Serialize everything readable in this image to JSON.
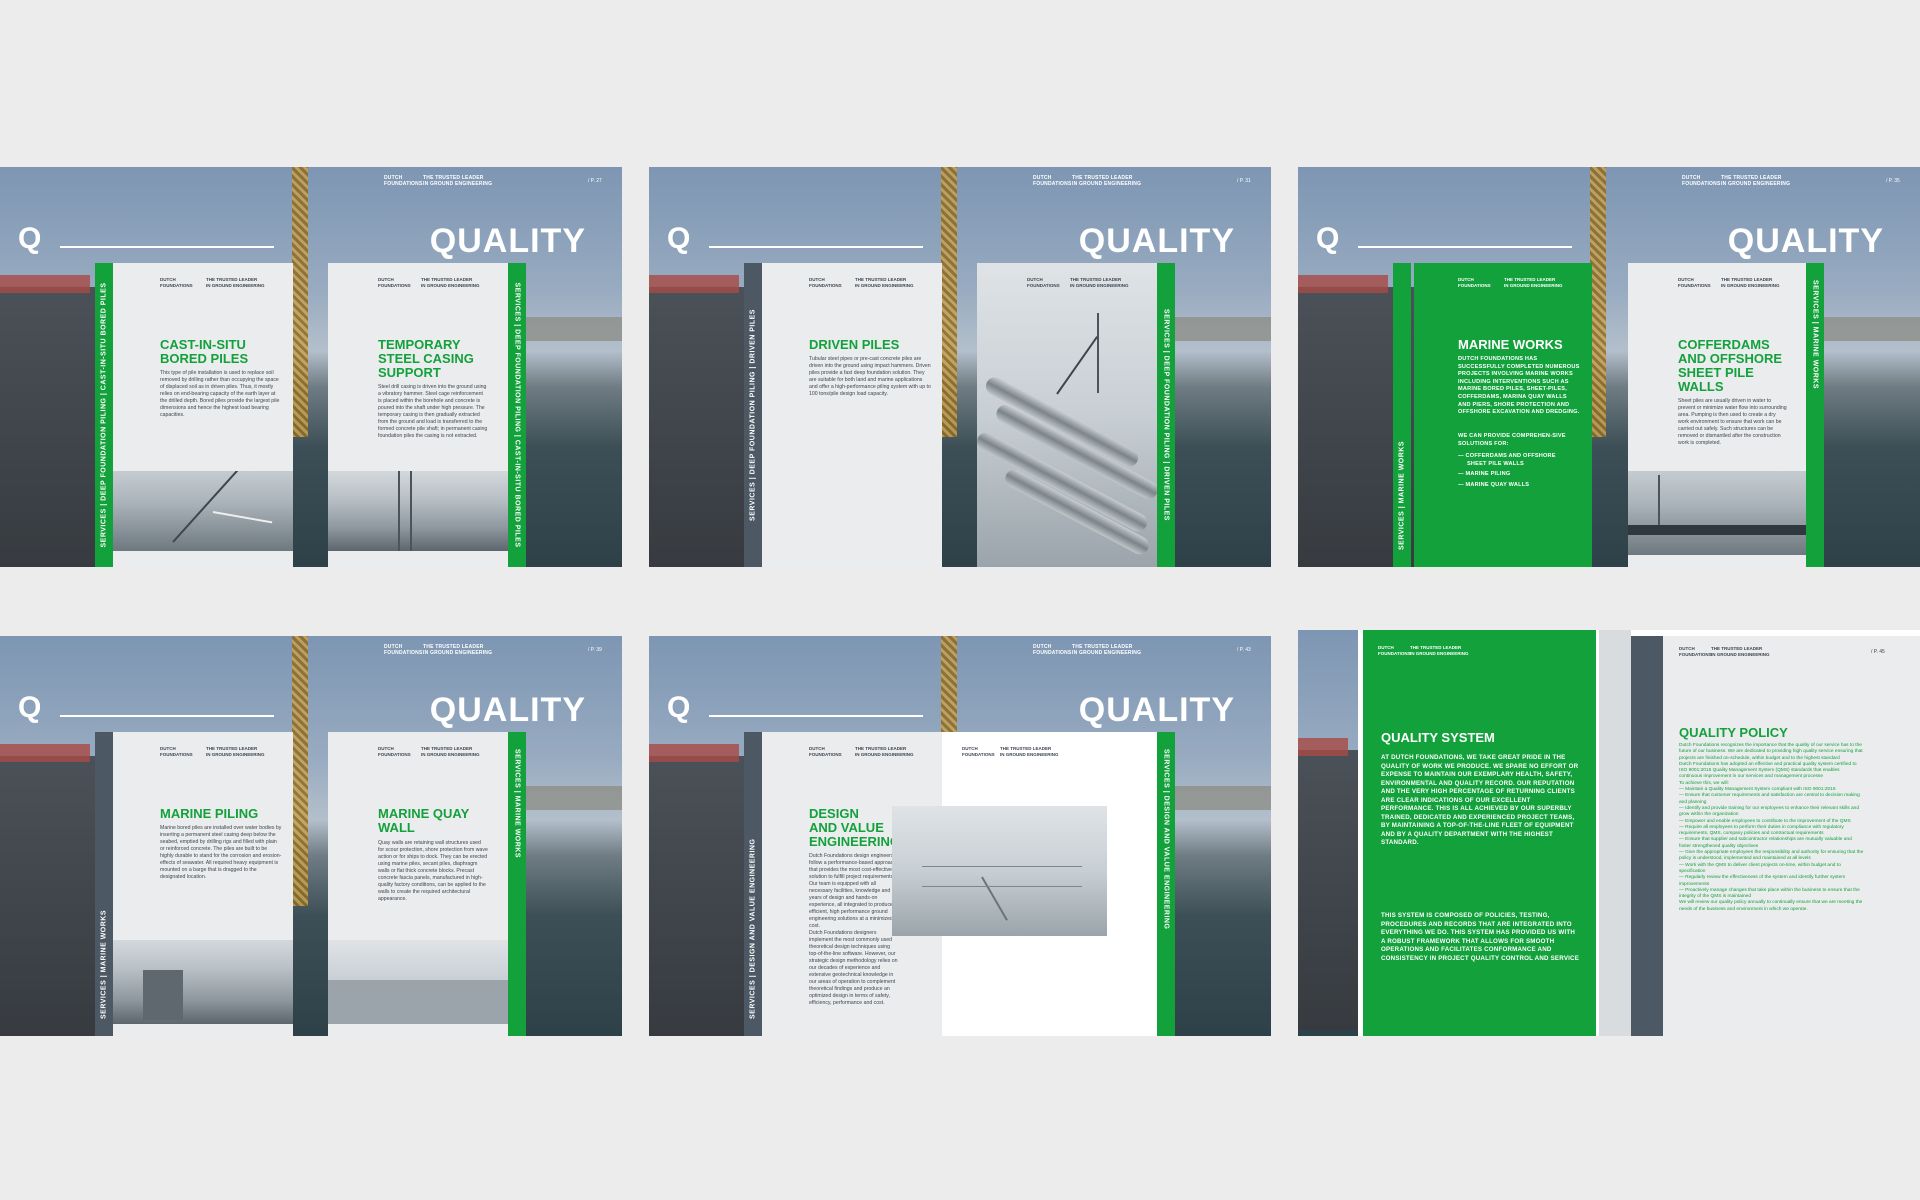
{
  "header": {
    "company_line1": "DUTCH",
    "company_line2": "FOUNDATIONS",
    "tag_line1": "THE TRUSTED LEADER",
    "tag_line2": "IN GROUND ENGINEERING"
  },
  "pages": {
    "p1": "/ P. 27",
    "p2": "/ P. 31",
    "p3": "/ P. 35",
    "p4": "/ P. 39",
    "p5": "/ P. 43",
    "p6": "/ P. 45"
  },
  "cover": {
    "letter": "Q",
    "word": "QUALITY"
  },
  "side": {
    "services": "SERVICES",
    "deep": "DEEP FOUNDATION PILING",
    "cast": "CAST-IN-SITU BORED PILES",
    "driven": "DRIVEN PILES",
    "marine": "MARINE WORKS",
    "design": "DESIGN AND VALUE ENGINEERING"
  },
  "s1": {
    "t1_l1": "CAST-IN-SITU",
    "t1_l2": "BORED PILES",
    "b1": "This type of pile installation is used to replace soil removed by drilling rather than occupying the space of displaced soil as in driven piles. Thus, it mostly relies on end-bearing capacity of the earth layer at the drilled depth. Bored piles provide the largest pile dimensions and hence the highest load bearing capacities.",
    "t2_l1": "TEMPORARY",
    "t2_l2": "STEEL CASING",
    "t2_l3": "SUPPORT",
    "b2": "Steel drill casing is driven into the ground using a vibratory hammer. Steel cage reinforcement is placed within the borehole and concrete is poured into the shaft under high pressure. The temporary casing is then gradually extracted from the ground and load is transferred to the formed concrete pile shaft; in permanent casing foundation piles the casing is not extracted."
  },
  "s2": {
    "t1": "DRIVEN PILES",
    "b1": "Tubular steel pipes or pre-cast concrete piles are driven into the ground using impact hammers. Driven piles provide a fast deep foundation solution. They are suitable for both land and marine applications and offer a high-performance piling system with up to 100 tons/pile design load capacity."
  },
  "s3": {
    "t1": "MARINE WORKS",
    "b1": "DUTCH FOUNDATIONS HAS SUCCESSFULLY COMPLETED NUMEROUS PROJECTS INVOLVING MARINE WORKS INCLUDING INTERVENTIONS SUCH AS MARINE BORED PILES, SHEET-PILES, COFFERDAMS, MARINA QUAY WALLS AND PIERS, SHORE PROTECTION AND OFFSHORE EXCAVATION AND DREDGING.",
    "b2": "WE CAN PROVIDE COMPREHEN-SIVE SOLUTIONS FOR:",
    "li1_l1": "— COFFERDAMS AND OFFSHORE",
    "li1_l2": "SHEET PILE WALLS",
    "li2": "— MARINE PILING",
    "li3": "— MARINE QUAY WALLS",
    "t2_l1": "COFFERDAMS",
    "t2_l2": "AND OFFSHORE",
    "t2_l3": "SHEET PILE",
    "t2_l4": "WALLS",
    "b3": "Sheet piles are usually driven in water to prevent or minimize water flow into surrounding area. Pumping is then used to create a dry work environment to ensure that work can be carried out safely. Such structures can be removed or dismantled after the construction work is completed."
  },
  "s4": {
    "t1": "MARINE PILING",
    "b1": "Marine bored piles are installed over water bodies by inserting a permanent steel casing deep below the seabed, emptied by drilling rigs and filled with plain or reinforced concrete. The piles are built to be highly durable to stand for the corrosion and erosion-effects of seawater. All required heavy equipment is mounted on a barge that is dragged to the designated location.",
    "t2_l1": "MARINE QUAY",
    "t2_l2": "WALL",
    "b2": "Quay walls are retaining wall structures used for scour protection, shore protection from wave action or for ships to dock. They can be erected using marine piles, secant piles, diaphragm walls or flat thick concrete blocks. Precast concrete fascia panels, manufactured in high-quality factory conditions, can be applied to the walls to create the required architectural appearance."
  },
  "s5": {
    "t1_l1": "DESIGN",
    "t1_l2": "AND VALUE",
    "t1_l3": "ENGINEERING",
    "b1": "Dutch Foundations design engineers follow a performance-based approach that provides the most cost-effective solution to fulfill project requirements.",
    "b2": "Our team is equipped with all necessary facilities, knowledge and years of design and hands-on experience, all integrated to produce efficient, high performance ground engineering solutions at a minimized cost.",
    "b3": "Dutch Foundations designers implement the most commonly used theoretical design techniques using top-of-the-line software. However, our strategic design methodology relies on our decades of experience and extensive geotechnical knowledge in our areas of operation to complement theoretical findings and produce an optimized design in terms of safety, efficiency, performance and cost."
  },
  "s6": {
    "t1": "QUALITY SYSTEM",
    "b1": "AT DUTCH FOUNDATIONS, WE TAKE GREAT PRIDE IN THE QUALITY OF WORK WE PRODUCE. WE SPARE NO EFFORT OR EXPENSE TO MAINTAIN OUR EXEMPLARY HEALTH, SAFETY, ENVIRONMENTAL AND QUALITY RECORD. OUR REPUTATION AND THE VERY HIGH PERCENTAGE OF RETURNING CLIENTS ARE CLEAR INDICATIONS OF OUR EXCELLENT PERFORMANCE. THIS IS ALL ACHIEVED BY OUR SUPERBLY TRAINED, DEDICATED AND EXPERIENCED PROJECT TEAMS, BY MAINTAINING A TOP-OF-THE-LINE FLEET OF EQUIPMENT AND BY A QUALITY DEPARTMENT WITH THE HIGHEST STANDARD.",
    "b2": "THIS SYSTEM IS COMPOSED OF POLICIES, TESTING, PROCEDURES AND RECORDS THAT ARE INTEGRATED INTO EVERYTHING WE DO. THIS SYSTEM HAS PROVIDED US WITH A ROBUST FRAMEWORK THAT ALLOWS FOR SMOOTH OPERATIONS AND FACILITATES CONFORMANCE AND CONSISTENCY IN PROJECT QUALITY CONTROL AND SERVICE",
    "t2": "QUALITY POLICY",
    "p1": "Dutch Foundations recognizes the importance that the quality of our service has to the future of our business. We are dedicated to providing high quality service ensuring that projects are finished on-schedule, within budget and to the highest standard",
    "p2": "Dutch Foundations has adopted an effective and practical quality system certified to ISO 9001:2015 Quality Management System (QMS) standards that enables continuous improvement in our services and management processe",
    "p3": "To achieve this, we will:",
    "l1": "— Maintain a Quality Management System compliant with ISO 9001:2015",
    "l2": "— Ensure that customer requirements and satisfaction are central to decision making and planning",
    "l3": "— Identify and provide training for our employees to enhance their relevant skills and grow within the organization",
    "l4": "— Empower and enable employees to contribute to the improvement of the QMS",
    "l5": "— Require all employees to perform their duties in compliance with regulatory requirements, QMS, company policies and contractual requirements",
    "l6": "— Ensure that supplier and subcontractor relationships are mutually valuable and foster strengthened quality objectives",
    "l7": "— Give the appropriate employees the responsibility and authority for ensuring that the policy is understood, implemented and maintained at all levels",
    "l8": "— Work with the QMS to deliver client projects on-time, within budget and to specification",
    "l9": "— Regularly review the effectiveness of the system and identify further system improvements",
    "l10": "— Proactively manage changes that take place within the business to ensure that the integrity of the QMS is maintained",
    "p4": "We will review our quality policy annually to continually ensure that we are meeting the needs of the business and environment in which we operate."
  }
}
